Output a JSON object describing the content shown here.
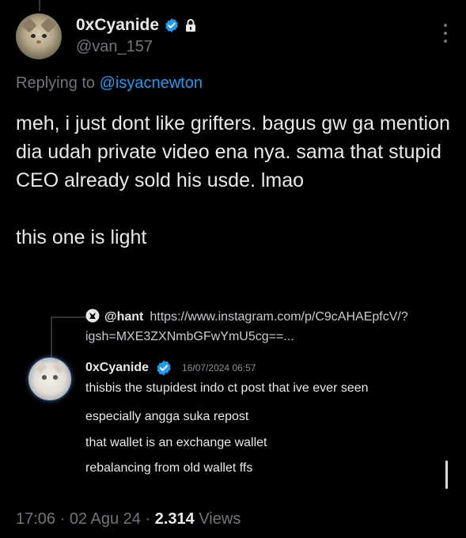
{
  "tweet": {
    "author": {
      "display_name": "0xCyanide",
      "handle": "@van_157",
      "avatar_icon": "cat-avatar",
      "verified_icon": "verified-badge-icon",
      "protected_icon": "lock-icon"
    },
    "menu_icon": "more-vertical-icon",
    "replying_prefix": "Replying to",
    "replying_to": "@isyacnewton",
    "text_para1": "meh, i just dont like grifters. bagus gw ga mention dia udah private video ena nya. sama that stupid CEO already sold his usde. lmao",
    "text_para2": "this one is light",
    "timestamp": "17:06 · 02 Agu 24 ·",
    "views_count": "2.314",
    "views_label": "Views"
  },
  "quoted": {
    "header_name": "@hant",
    "header_url": "https://www.instagram.com/p/C9cAHAEpfcV/?igsh=MXE3ZXNmbGFwYmU5cg==...",
    "author_name": "0xCyanide",
    "date": "16/07/2024 06:57",
    "lines": [
      "thisbis the stupidest indo ct post that ive ever seen",
      "especially angga suka repost",
      "that wallet is an exchange wallet",
      "rebalancing from old wallet ffs"
    ]
  },
  "colors": {
    "background": "#000000",
    "text": "#e7e9ea",
    "muted": "#71767b",
    "accent": "#1d9bf0"
  }
}
